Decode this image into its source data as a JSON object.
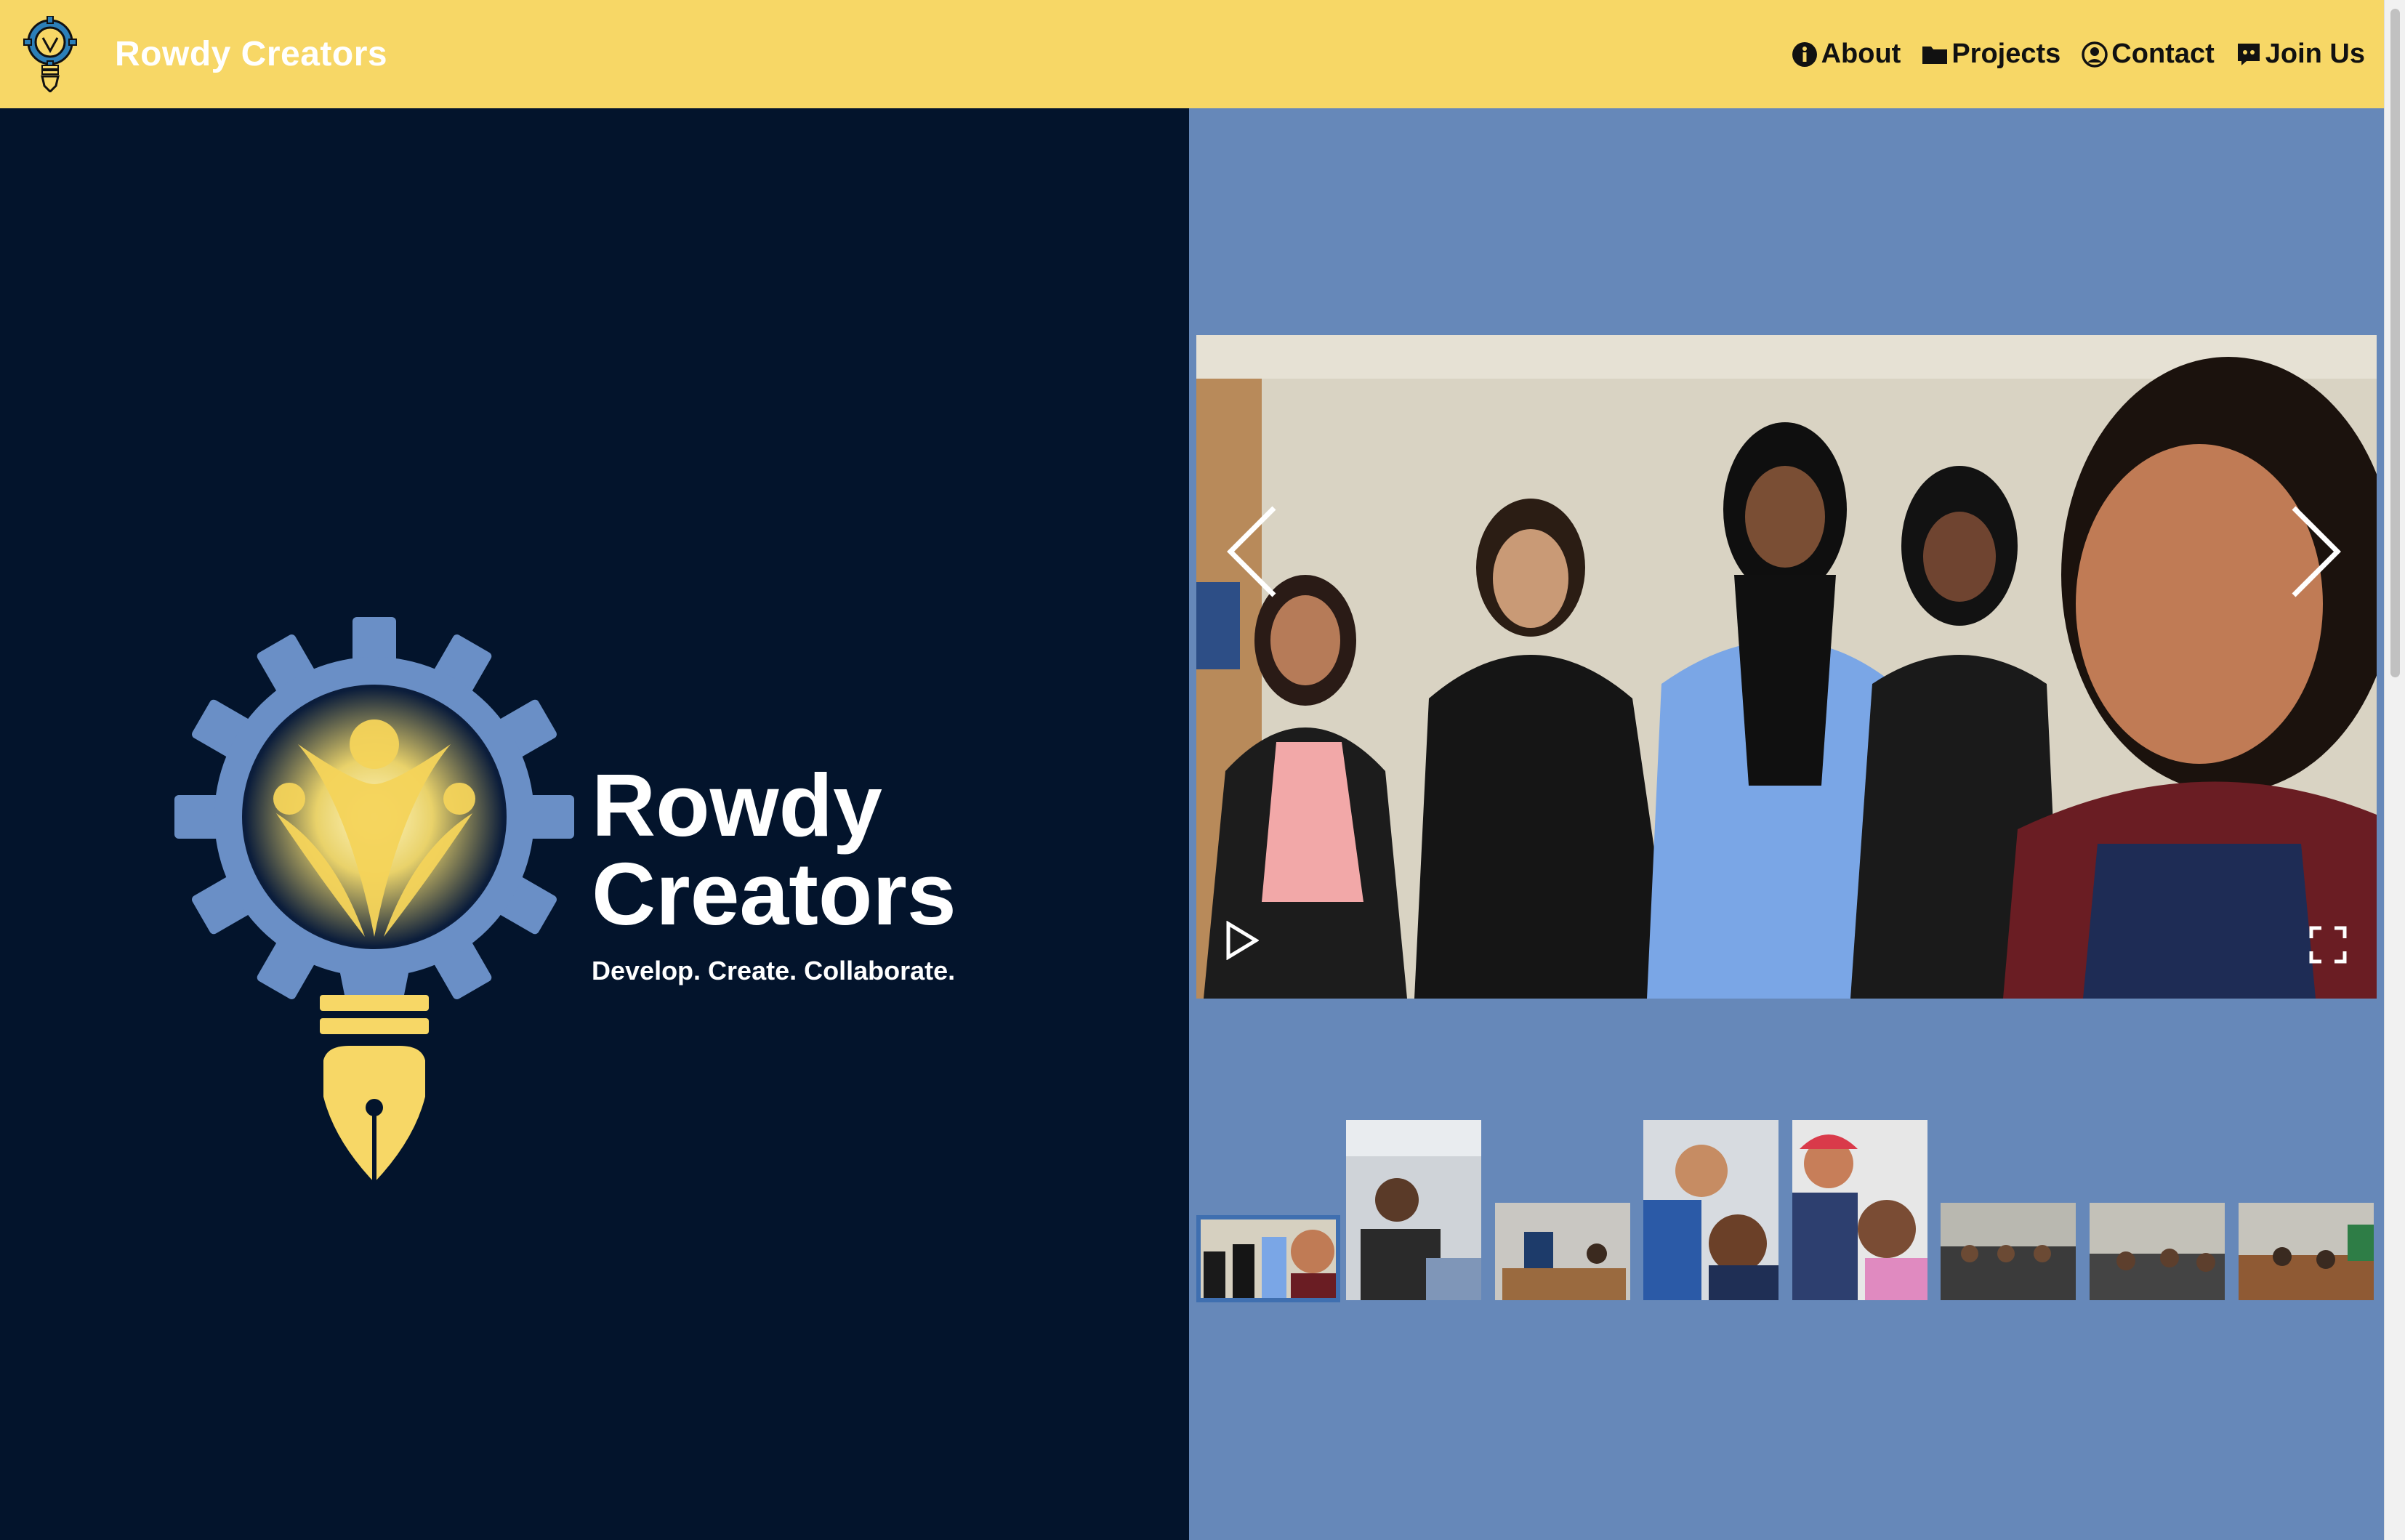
{
  "header": {
    "brand": "Rowdy Creators",
    "nav": [
      {
        "label": "About",
        "icon": "info-icon"
      },
      {
        "label": "Projects",
        "icon": "folder-icon"
      },
      {
        "label": "Contact",
        "icon": "user-circle-icon"
      },
      {
        "label": "Join Us",
        "icon": "discord-icon"
      }
    ]
  },
  "hero": {
    "title_line1": "Rowdy",
    "title_line2": "Creators",
    "tagline": "Develop. Create. Collaborate."
  },
  "gallery": {
    "current_index": 0,
    "thumbnail_count": 8,
    "controls": [
      "previous",
      "next",
      "play",
      "fullscreen"
    ]
  },
  "colors": {
    "navbar": "#f7d766",
    "hero_bg": "#03142c",
    "gallery_bg": "#6688b9",
    "accent_yellow": "#f7d766",
    "gear_blue": "#6a8fc6"
  }
}
